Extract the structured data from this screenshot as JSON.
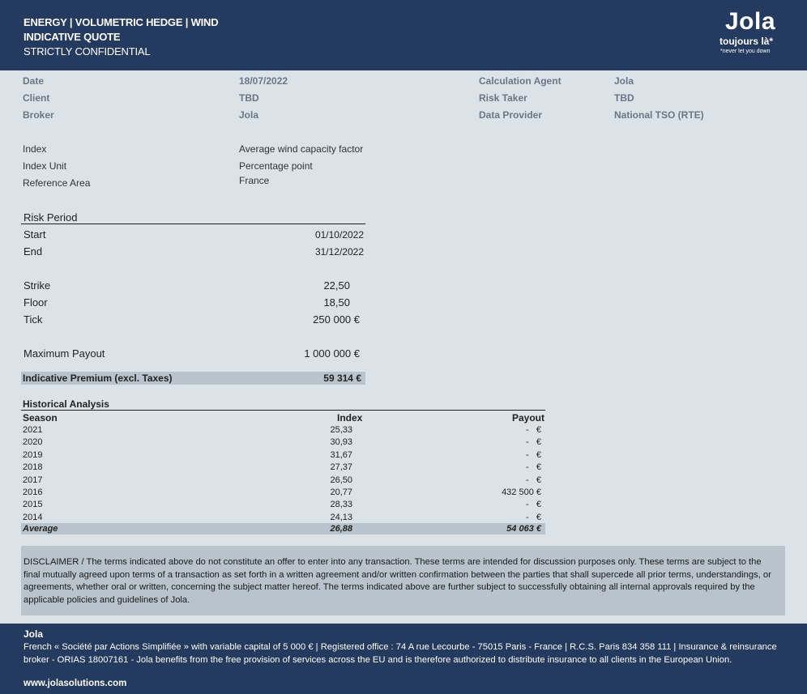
{
  "header": {
    "line1": "ENERGY | VOLUMETRIC HEDGE | WIND",
    "line2": "INDICATIVE QUOTE",
    "line3": "STRICTLY CONFIDENTIAL",
    "logo": "Jola",
    "tagline": "toujours là*",
    "tagline_sub": "*never let you down"
  },
  "info": {
    "date_label": "Date",
    "date": "18/07/2022",
    "client_label": "Client",
    "client": "TBD",
    "broker_label": "Broker",
    "broker": "Jola",
    "agent_label": "Calculation Agent",
    "agent": "Jola",
    "risk_taker_label": "Risk Taker",
    "risk_taker": "TBD",
    "provider_label": "Data Provider",
    "provider": "National TSO (RTE)"
  },
  "index": {
    "index_label": "Index",
    "index": "Average wind capacity factor",
    "unit_label": "Index Unit",
    "unit": "Percentage point",
    "area_label": "Reference Area",
    "area": "France"
  },
  "risk": {
    "title": "Risk Period",
    "start_label": "Start",
    "start": "01/10/2022",
    "end_label": "End",
    "end": "31/12/2022",
    "strike_label": "Strike",
    "strike": "22,50",
    "floor_label": "Floor",
    "floor": "18,50",
    "tick_label": "Tick",
    "tick": "250 000 €",
    "max_label": "Maximum Payout",
    "max": "1 000 000 €",
    "premium_label": "Indicative Premium (excl. Taxes)",
    "premium": "59 314 €"
  },
  "historical": {
    "title": "Historical Analysis",
    "headers": [
      "Season",
      "Index",
      "Payout"
    ],
    "rows": [
      [
        "2021",
        "25,33",
        "-   €"
      ],
      [
        "2020",
        "30,93",
        "-   €"
      ],
      [
        "2019",
        "31,67",
        "-   €"
      ],
      [
        "2018",
        "27,37",
        "-   €"
      ],
      [
        "2017",
        "26,50",
        "-   €"
      ],
      [
        "2016",
        "20,77",
        "432 500 €"
      ],
      [
        "2015",
        "28,33",
        "-   €"
      ],
      [
        "2014",
        "24,13",
        "-   €"
      ]
    ],
    "average": [
      "Average",
      "26,88",
      "54 063 €"
    ]
  },
  "disclaimer": "DISCLAIMER / The terms indicated above do not constitute an offer to enter into any transaction. These terms are intended for discussion purposes only. These terms are subject to the final mutually agreed upon terms of a transaction as set forth in a written agreement and/or written confirmation between the parties that shall supercede all prior terms, understandings, or agreements, whether oral or written, concerning the subject matter hereof.  The terms indicated above are further subject to successfully obtaining all internal approvals required by the applicable policies and guidelines of Jola.",
  "footer": {
    "name": "Jola",
    "text": "French « Société par Actions Simplifiée » with variable capital of 5 000 € | Registered office : 74 A rue Lecourbe - 75015 Paris - France | R.C.S. Paris 834 358 111 | Insurance & reinsurance broker - ORIAS 18007161 - Jola benefits from the free provision of services across the EU and is therefore authorized to distribute insurance to all clients in the European Union.",
    "website": "www.jolasolutions.com"
  },
  "colors": {
    "navy": "#243a5e",
    "background": "#dce3e8",
    "band": "#b9c3cb"
  }
}
